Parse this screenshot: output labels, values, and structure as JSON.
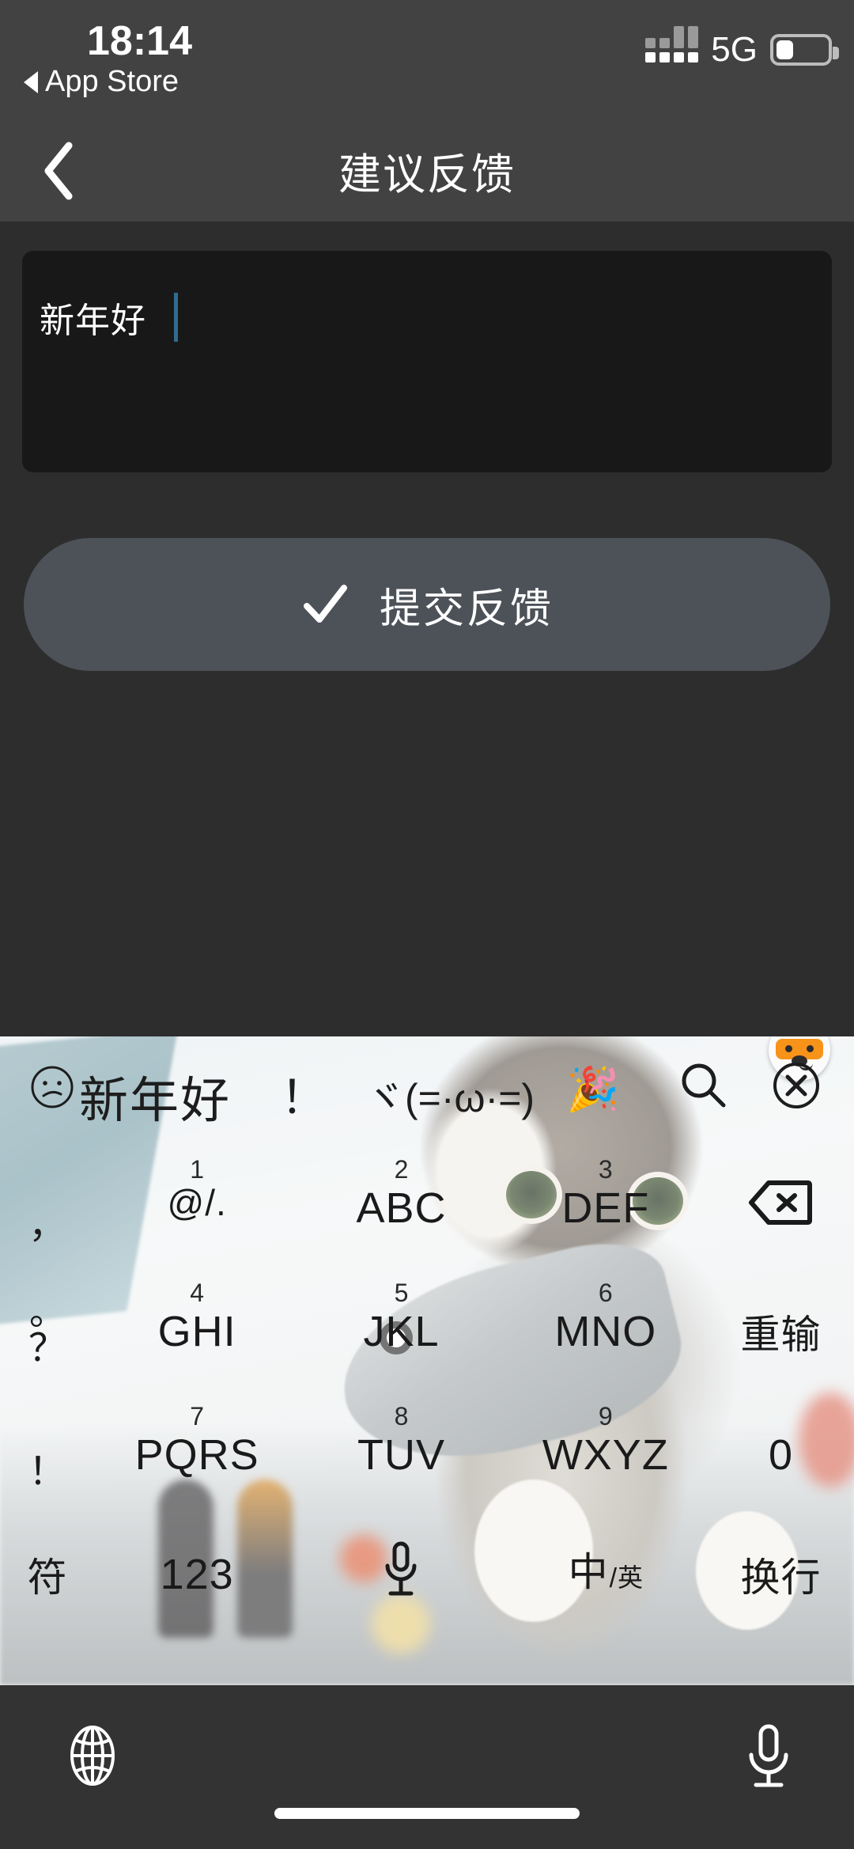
{
  "status_bar": {
    "time": "18:14",
    "back_app_label": "App Store",
    "network": "5G",
    "battery_level_percent": 22,
    "signal_icon": "signal-dots-icon",
    "battery_icon": "battery-low-icon"
  },
  "nav_bar": {
    "back_icon": "chevron-left-icon",
    "title": "建议反馈"
  },
  "feedback_form": {
    "textarea_value": "新年好",
    "textarea_placeholder": "",
    "caret_color": "#2f6d8f",
    "submit_label": "提交反馈",
    "submit_icon": "check-icon",
    "submit_bg": "#4d5259"
  },
  "keyboard": {
    "avatar_icon": "ime-cat-mascot-icon",
    "candidates": {
      "emoticon_icon": "confused-face-icon",
      "items": [
        {
          "text": "新年好",
          "name": "candidate-xinnianhao"
        },
        {
          "text": "！",
          "name": "candidate-exclamation"
        },
        {
          "text": "ヾ(=·ω·=)",
          "name": "candidate-kaomoji"
        }
      ],
      "party_emoji": "🎉",
      "search_icon": "search-icon",
      "close_icon": "close-circle-icon"
    },
    "rows": [
      {
        "name": "keyboard-row-1",
        "keys": [
          {
            "name": "key-comma",
            "num": "",
            "label": "，",
            "type": "punct-top"
          },
          {
            "name": "key-1",
            "num": "1",
            "label": "@/.",
            "type": "sym"
          },
          {
            "name": "key-2",
            "num": "2",
            "label": "ABC",
            "type": "alpha"
          },
          {
            "name": "key-3",
            "num": "3",
            "label": "DEF",
            "type": "alpha"
          },
          {
            "name": "key-backspace",
            "num": "",
            "label": "",
            "type": "backspace"
          }
        ]
      },
      {
        "name": "keyboard-row-2",
        "keys": [
          {
            "name": "key-period-question",
            "num": "",
            "label": "。",
            "type": "punct-pair",
            "label2": "？"
          },
          {
            "name": "key-4",
            "num": "4",
            "label": "GHI",
            "type": "alpha"
          },
          {
            "name": "key-5",
            "num": "5",
            "label": "JKL",
            "type": "alpha"
          },
          {
            "name": "key-6",
            "num": "6",
            "label": "MNO",
            "type": "alpha"
          },
          {
            "name": "key-redo",
            "num": "",
            "label": "重输",
            "type": "cn"
          }
        ]
      },
      {
        "name": "keyboard-row-3",
        "keys": [
          {
            "name": "key-exclamation",
            "num": "",
            "label": "！",
            "type": "punct-bot"
          },
          {
            "name": "key-7",
            "num": "7",
            "label": "PQRS",
            "type": "alpha"
          },
          {
            "name": "key-8",
            "num": "8",
            "label": "TUV",
            "type": "alpha"
          },
          {
            "name": "key-9",
            "num": "9",
            "label": "WXYZ",
            "type": "alpha"
          },
          {
            "name": "key-0",
            "num": "",
            "label": "0",
            "type": "alpha"
          }
        ]
      },
      {
        "name": "keyboard-row-4",
        "keys": [
          {
            "name": "key-symbols",
            "num": "",
            "label": "符",
            "type": "cn"
          },
          {
            "name": "key-123",
            "num": "",
            "label": "123",
            "type": "alpha"
          },
          {
            "name": "key-voice",
            "num": "",
            "label": "",
            "type": "mic"
          },
          {
            "name": "key-lang-toggle",
            "num": "",
            "label": "中",
            "type": "lang",
            "label2": "英",
            "separator": "/"
          },
          {
            "name": "key-newline",
            "num": "",
            "label": "换行",
            "type": "cn"
          }
        ]
      }
    ]
  },
  "bottom_bar": {
    "globe_icon": "globe-icon",
    "mic_icon": "microphone-icon",
    "home_indicator": "home-indicator"
  },
  "colors": {
    "page_bg": "#2d2d2d",
    "bar_bg": "#424242",
    "textarea_bg": "#181818",
    "bottom_bar_bg": "#333333",
    "accent_text": "#ffffff"
  }
}
